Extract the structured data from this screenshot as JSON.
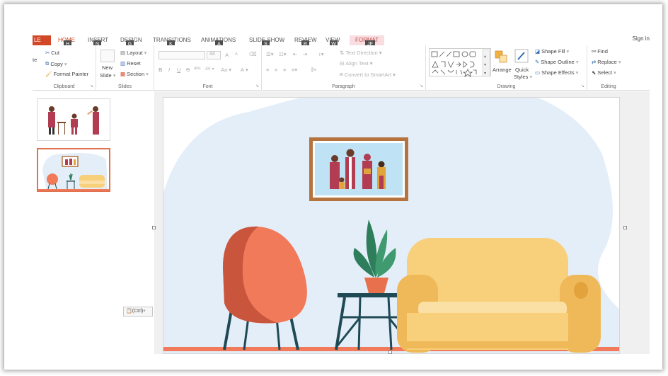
{
  "tabs": {
    "file": "LE",
    "home": "HOME",
    "insert": "INSERT",
    "design": "DESIGN",
    "transitions": "TRANSITIONS",
    "animations": "ANIMATIONS",
    "slideshow": "SLIDE SHOW",
    "review": "REVIEW",
    "view": "VIEW",
    "format": "FORMAT",
    "signin": "Sign in"
  },
  "keytips": [
    "H",
    "N",
    "G",
    "K",
    "A",
    "S",
    "R",
    "W",
    "JF"
  ],
  "ribbon": {
    "clipboard": {
      "label": "Clipboard",
      "paste_partial": "te",
      "cut": "Cut",
      "copy": "Copy",
      "format_painter": "Format Painter"
    },
    "slides": {
      "label": "Slides",
      "new_slide": "New",
      "new_slide_2": "Slide",
      "layout": "Layout",
      "reset": "Reset",
      "section": "Section"
    },
    "font": {
      "label": "Font",
      "size": "44",
      "grow": "A",
      "shrink": "A",
      "bold": "B",
      "italic": "I",
      "underline": "U",
      "strike": "S",
      "abc": "abc",
      "spacing": "AV",
      "case": "Aa",
      "color": "A"
    },
    "paragraph": {
      "label": "Paragraph",
      "text_direction": "Text Direction",
      "align_text": "Align Text",
      "convert_smartart": "Convert to SmartArt"
    },
    "drawing": {
      "label": "Drawing",
      "arrange": "Arrange",
      "quick_styles": "Quick",
      "quick_styles_2": "Styles",
      "shape_fill": "Shape Fill",
      "shape_outline": "Shape Outline",
      "shape_effects": "Shape Effects"
    },
    "editing": {
      "label": "Editing",
      "find": "Find",
      "replace": "Replace",
      "select": "Select"
    }
  },
  "panel": {
    "paste_options": "(Ctrl)"
  },
  "colors": {
    "accent": "#d24726",
    "blob": "#e4eef9",
    "chair": "#f07a5a",
    "chair_dark": "#c9553d",
    "sofa": "#f8cf7a",
    "sofa_dark": "#efb95a",
    "table": "#1f4a55",
    "plant": "#2e7d5b",
    "pot": "#e8704c",
    "frame": "#b5733e",
    "floor": "#f07a5a"
  }
}
